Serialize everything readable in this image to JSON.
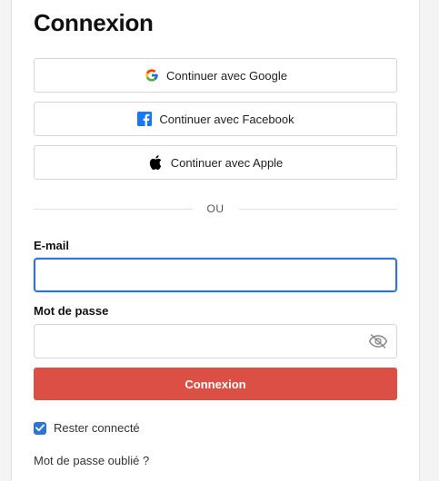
{
  "title": "Connexion",
  "social": {
    "google_label": "Continuer avec Google",
    "facebook_label": "Continuer avec Facebook",
    "apple_label": "Continuer avec Apple"
  },
  "divider_text": "OU",
  "form": {
    "email_label": "E-mail",
    "email_value": "",
    "password_label": "Mot de passe",
    "password_value": "",
    "submit_label": "Connexion",
    "remember_label": "Rester connecté",
    "remember_checked": true,
    "forgot_label": "Mot de passe oublié ?"
  },
  "colors": {
    "submit_bg": "#dc4f45",
    "focus_border": "#2e74d6",
    "checkbox": "#2e74d6",
    "facebook_blue": "#1877f2"
  },
  "icons": {
    "google": "google-logo-icon",
    "facebook": "facebook-logo-icon",
    "apple": "apple-logo-icon",
    "password_toggle": "eye-slash-icon",
    "checkbox_mark": "checkmark-icon"
  }
}
